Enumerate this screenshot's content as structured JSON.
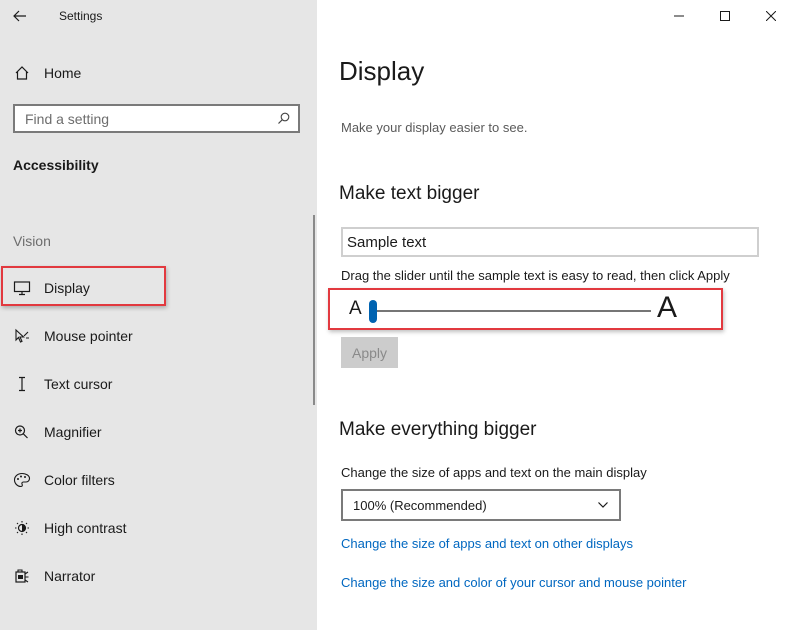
{
  "window": {
    "title": "Settings"
  },
  "sidebar": {
    "home_label": "Home",
    "search_placeholder": "Find a setting",
    "section_heading": "Accessibility",
    "group_heading": "Vision",
    "items": [
      {
        "label": "Display",
        "icon": "monitor-icon"
      },
      {
        "label": "Mouse pointer",
        "icon": "mouse-pointer-icon"
      },
      {
        "label": "Text cursor",
        "icon": "text-cursor-icon"
      },
      {
        "label": "Magnifier",
        "icon": "magnifier-icon"
      },
      {
        "label": "Color filters",
        "icon": "color-filters-icon"
      },
      {
        "label": "High contrast",
        "icon": "high-contrast-icon"
      },
      {
        "label": "Narrator",
        "icon": "narrator-icon"
      }
    ],
    "selected": "Display"
  },
  "main": {
    "title": "Display",
    "subtitle": "Make your display easier to see.",
    "text_bigger": {
      "heading": "Make text bigger",
      "sample_text": "Sample text",
      "hint": "Drag the slider until the sample text is easy to read, then click Apply",
      "slider_small_label": "A",
      "slider_large_label": "A",
      "slider_value_fraction": 0.0,
      "apply_label": "Apply"
    },
    "everything_bigger": {
      "heading": "Make everything bigger",
      "description": "Change the size of apps and text on the main display",
      "scale_value": "100% (Recommended)",
      "link_other_displays": "Change the size of apps and text on other displays",
      "link_cursor": "Change the size and color of your cursor and mouse pointer"
    }
  },
  "colors": {
    "accent": "#0063b1",
    "link": "#0067c0",
    "highlight_annotation": "#e2393f",
    "sidebar_bg": "#e6e6e6"
  }
}
